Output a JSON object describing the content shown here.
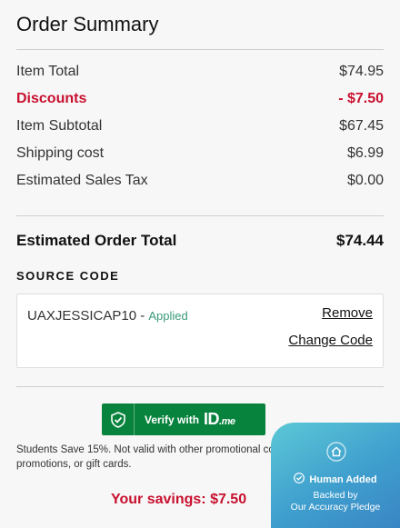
{
  "summary": {
    "title": "Order Summary",
    "rows": [
      {
        "label": "Item Total",
        "value": "$74.95"
      },
      {
        "label": "Discounts",
        "value": "- $7.50"
      },
      {
        "label": "Item Subtotal",
        "value": "$67.45"
      },
      {
        "label": "Shipping cost",
        "value": "$6.99"
      },
      {
        "label": "Estimated Sales Tax",
        "value": "$0.00"
      }
    ],
    "total_label": "Estimated Order Total",
    "total_value": "$74.44"
  },
  "source_code": {
    "label": "SOURCE CODE",
    "code": "UAXJESSICAP10 - ",
    "status": "Applied",
    "remove_label": "Remove",
    "change_label": "Change Code"
  },
  "idme": {
    "verify_label": "Verify with",
    "logo_text": "ID",
    "logo_suffix": ".me"
  },
  "disclaimer": "Students Save 15%. Not valid with other promotional codes, sitewide promotions, or gift cards.",
  "savings": "Your savings: $7.50",
  "badge": {
    "title": "Human Added",
    "line1": "Backed by",
    "line2": "Our Accuracy Pledge"
  },
  "colors": {
    "discount": "#c8102e",
    "idme_green": "#08833d",
    "applied": "#3a9a7a",
    "badge_blue": "#3f9fce"
  }
}
